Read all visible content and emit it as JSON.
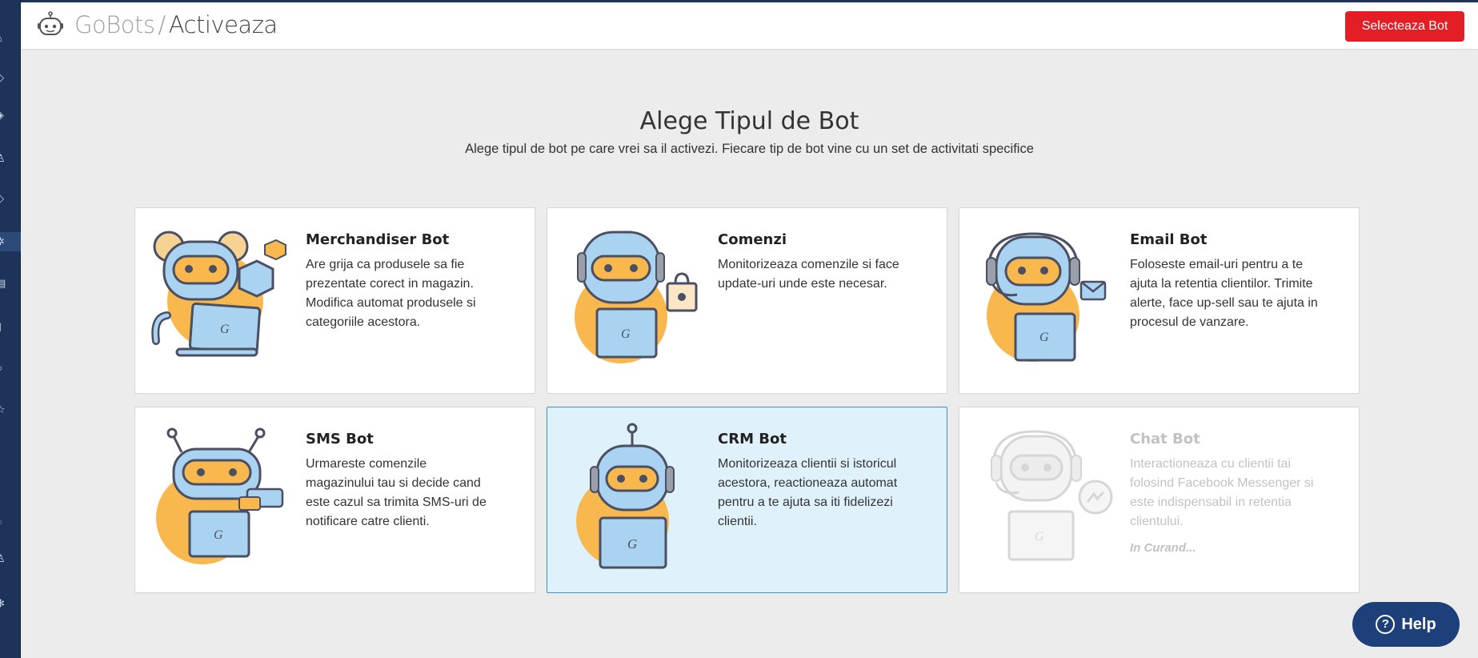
{
  "app": {
    "name": "GoBots",
    "separator": "/",
    "page": "Activeaza",
    "brand_icon": "robot-icon"
  },
  "header": {
    "select_button": "Selecteaza Bot"
  },
  "sidebar": {
    "items": [
      {
        "icon": "home-icon",
        "glyph": "⌂"
      },
      {
        "icon": "tag-icon",
        "glyph": "◇"
      },
      {
        "icon": "tags-icon",
        "glyph": "◈"
      },
      {
        "icon": "users-icon",
        "glyph": "♙"
      },
      {
        "icon": "price-tag-icon",
        "glyph": "◇"
      },
      {
        "icon": "settings-cog-icon",
        "glyph": "✲"
      },
      {
        "icon": "document-icon",
        "glyph": "▤"
      },
      {
        "icon": "clipboard-icon",
        "glyph": "▯"
      },
      {
        "icon": "circle-icon",
        "glyph": "○"
      },
      {
        "icon": "star-icon",
        "glyph": "☆"
      },
      {
        "icon": "dot-icon",
        "glyph": "•"
      },
      {
        "icon": "power-icon",
        "glyph": "◌"
      },
      {
        "icon": "user-icon",
        "glyph": "♙"
      },
      {
        "icon": "gear-icon",
        "glyph": "✻"
      }
    ]
  },
  "main": {
    "title": "Alege Tipul de Bot",
    "subtitle": "Alege tipul de bot pe care vrei sa il activezi. Fiecare tip de bot vine cu un set de activitati specifice"
  },
  "cards": [
    {
      "title": "Merchandiser Bot",
      "description": "Are grija ca produsele sa fie prezentate corect in magazin. Modifica automat produsele si categoriile acestora.",
      "icon": "merchandiser-robot-icon"
    },
    {
      "title": "Comenzi",
      "description": "Monitorizeaza comenzile si face update-uri unde este necesar.",
      "icon": "orders-robot-icon"
    },
    {
      "title": "Email Bot",
      "description": "Foloseste email-uri pentru a te ajuta la retentia clientilor. Trimite alerte, face up-sell sau te ajuta in procesul de vanzare.",
      "icon": "email-robot-icon"
    },
    {
      "title": "SMS Bot",
      "description": "Urmareste comenzile magazinului tau si decide cand este cazul sa trimita SMS-uri de notificare catre clienti.",
      "icon": "sms-robot-icon"
    },
    {
      "title": "CRM Bot",
      "description": "Monitorizeaza clientii si istoricul acestora, reactioneaza automat pentru a te ajuta sa iti fidelizezi clientii.",
      "icon": "crm-robot-icon",
      "state": "selected"
    },
    {
      "title": "Chat Bot",
      "description": "Interactioneaza cu clientii tai folosind Facebook Messenger si este indispensabil in retentia clientului.",
      "icon": "chat-robot-icon",
      "state": "disabled",
      "badge": "In Curand..."
    }
  ],
  "help": {
    "label": "Help",
    "glyph": "?",
    "icon": "question-icon"
  },
  "colors": {
    "sidebar": "#1d3359",
    "primary_button": "#e41e26",
    "help_button": "#1d3f7a",
    "selected_card": "#dff1fb",
    "robot_blue": "#a9d3f0",
    "robot_orange": "#f8b84e"
  }
}
